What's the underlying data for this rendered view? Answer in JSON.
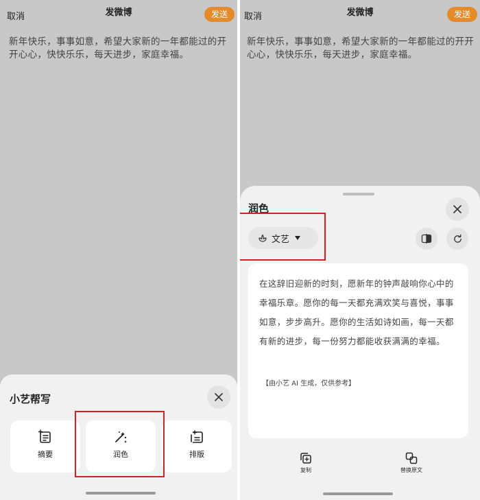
{
  "left": {
    "cancel": "取消",
    "title": "发微博",
    "send": "发送",
    "post": "新年快乐，事事如意，希望大家新的一年都能过的开开心心，快快乐乐，每天进步，家庭幸福。",
    "sheet": {
      "title": "小艺帮写",
      "tools": [
        {
          "label": "摘要",
          "icon": "summary-icon"
        },
        {
          "label": "润色",
          "icon": "magic-wand-icon"
        },
        {
          "label": "排版",
          "icon": "layout-icon"
        }
      ]
    }
  },
  "right": {
    "cancel": "取消",
    "title": "发微博",
    "send": "发送",
    "post": "新年快乐，事事如意，希望大家新的一年都能过的开开心心，快快乐乐，每天进步，家庭幸福。",
    "sheet": {
      "title": "润色",
      "style": "文艺",
      "result": "在这辞旧迎新的时刻，愿新年的钟声敲响你心中的幸福乐章。愿你的每一天都充满欢笑与喜悦，事事如意，步步高升。愿你的生活如诗如画，每一天都有新的进步，每一份努力都能收获满满的幸福。",
      "note": "【由小艺 AI 生成，仅供参考】",
      "actions": [
        {
          "label": "复制",
          "icon": "copy-icon"
        },
        {
          "label": "替换原文",
          "icon": "replace-icon"
        }
      ]
    }
  },
  "colors": {
    "accent": "#e58b2a",
    "highlight": "#d62020",
    "background": "#c8c8c8",
    "sheet": "#f1f1f1"
  }
}
